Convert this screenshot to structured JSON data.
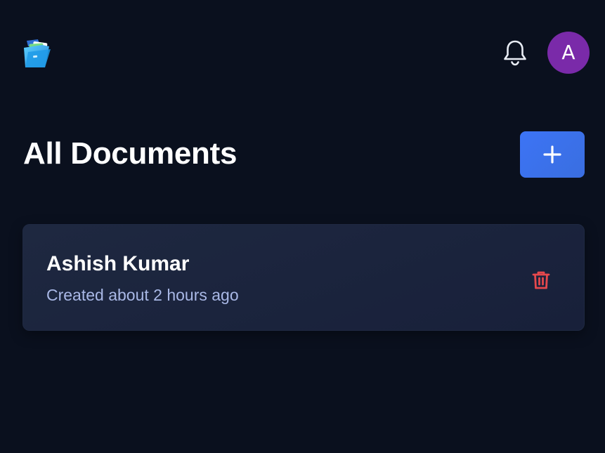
{
  "header": {
    "logo_icon": "folder-documents-icon",
    "notification_icon": "bell-icon",
    "avatar_initial": "A",
    "avatar_color": "#7a2aa9"
  },
  "main": {
    "title": "All Documents",
    "add_button_icon": "plus-icon",
    "add_button_color": "#3c74f5"
  },
  "documents": [
    {
      "title": "Ashish Kumar",
      "meta": "Created about 2 hours ago",
      "delete_icon": "trash-icon",
      "delete_color": "#e5484d"
    }
  ],
  "colors": {
    "background": "#0a101e",
    "card": "#1b2339",
    "meta_text": "#a9b8e6"
  }
}
